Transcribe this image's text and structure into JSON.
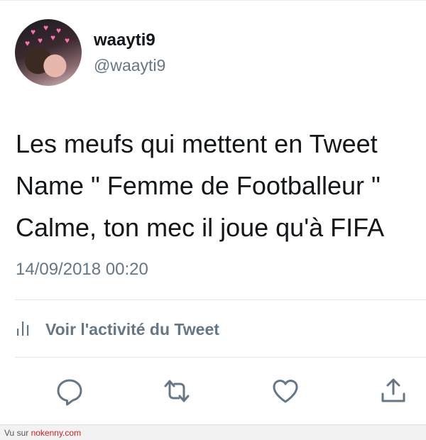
{
  "tweet": {
    "display_name": "waayti9",
    "handle": "@waayti9",
    "text_lines": [
      "Les meufs qui mettent en Tweet",
      "Name \" Femme de Footballeur \"",
      "Calme, ton mec il joue qu'à FIFA"
    ],
    "timestamp": "14/09/2018 00:20",
    "activity_label": "Voir l'activité du Tweet"
  },
  "actions": [
    {
      "name": "reply-icon"
    },
    {
      "name": "retweet-icon"
    },
    {
      "name": "like-icon"
    },
    {
      "name": "share-icon"
    }
  ],
  "footer": {
    "prefix": "Vu sur ",
    "site": "nokenny.com"
  },
  "colors": {
    "primary_text": "#14171a",
    "secondary_text": "#657786",
    "divider": "#e1e8ed",
    "footer_link": "#cc2222"
  }
}
